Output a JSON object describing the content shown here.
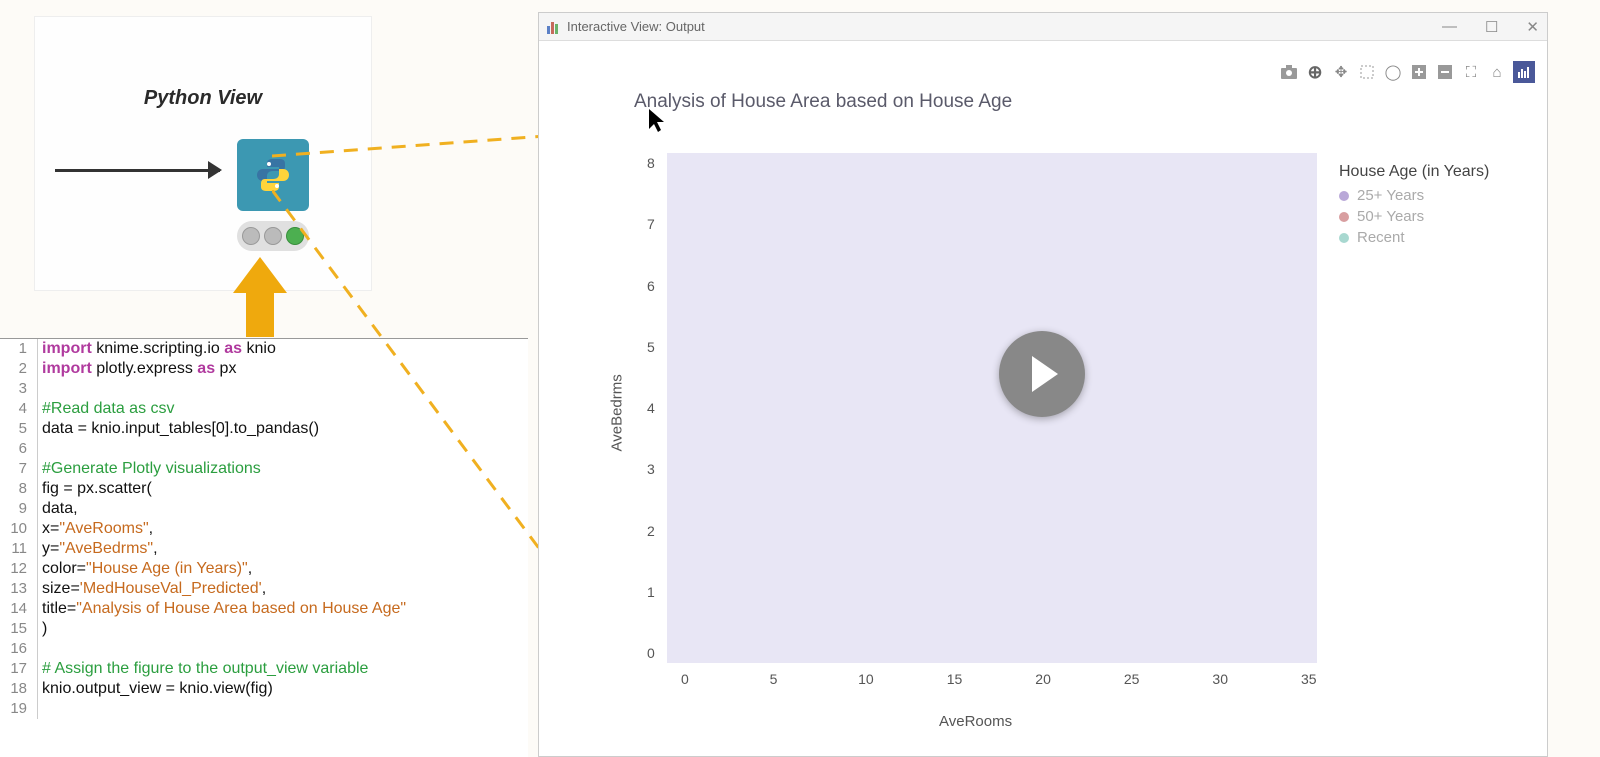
{
  "node": {
    "title": "Python View"
  },
  "window": {
    "title": "Interactive View: Output"
  },
  "plotly_toolbar": {
    "camera": "camera-icon",
    "zoom": "zoom-icon",
    "pan": "pan-icon",
    "boxselect": "box-select-icon",
    "lasso": "lasso-icon",
    "zoomin": "zoom-in-icon",
    "zoomout": "zoom-out-icon",
    "autoscale": "autoscale-icon",
    "reset": "reset-icon",
    "logo": "plotly-logo-icon"
  },
  "chart": {
    "title": "Analysis of House Area based on House Age",
    "xlabel": "AveRooms",
    "ylabel": "AveBedrms",
    "legend_title": "House Age (in Years)",
    "legend_items": [
      {
        "label": "25+ Years",
        "color": "#b9a8d8"
      },
      {
        "label": "50+ Years",
        "color": "#d89ea0"
      },
      {
        "label": "Recent",
        "color": "#a8d8d0"
      }
    ],
    "xticks": [
      "0",
      "5",
      "10",
      "15",
      "20",
      "25",
      "30",
      "35"
    ],
    "yticks": [
      "0",
      "1",
      "2",
      "3",
      "4",
      "5",
      "6",
      "7",
      "8"
    ]
  },
  "chart_data": {
    "type": "scatter",
    "title": "Analysis of House Area based on House Age",
    "xlabel": "AveRooms",
    "ylabel": "AveBedrms",
    "xlim": [
      0,
      36
    ],
    "ylim": [
      0,
      8.5
    ],
    "legend_title": "House Age (in Years)",
    "series": [
      {
        "name": "25+ Years",
        "x": [],
        "y": [],
        "size": []
      },
      {
        "name": "50+ Years",
        "x": [],
        "y": [],
        "size": []
      },
      {
        "name": "Recent",
        "x": [],
        "y": [],
        "size": []
      }
    ],
    "note": "scatter plot rendered empty/blank in screenshot; no visible data points"
  },
  "code": {
    "lines": [
      {
        "n": "1",
        "tokens": [
          {
            "t": "import ",
            "c": "kw"
          },
          {
            "t": "knime.scripting.io "
          },
          {
            "t": "as",
            "c": "kw"
          },
          {
            "t": " knio"
          }
        ]
      },
      {
        "n": "2",
        "tokens": [
          {
            "t": "import ",
            "c": "kw"
          },
          {
            "t": "plotly.express "
          },
          {
            "t": "as",
            "c": "kw"
          },
          {
            "t": " px"
          }
        ]
      },
      {
        "n": "3",
        "tokens": []
      },
      {
        "n": "4",
        "tokens": [
          {
            "t": "#Read data as csv",
            "c": "cm"
          }
        ]
      },
      {
        "n": "5",
        "tokens": [
          {
            "t": "data = knio.input_tables[0].to_pandas()"
          }
        ]
      },
      {
        "n": "6",
        "tokens": []
      },
      {
        "n": "7",
        "tokens": [
          {
            "t": "#Generate Plotly visualizations",
            "c": "cm"
          }
        ]
      },
      {
        "n": "8",
        "tokens": [
          {
            "t": "fig = px.scatter("
          }
        ]
      },
      {
        "n": "9",
        "tokens": [
          {
            "t": "data,"
          }
        ]
      },
      {
        "n": "10",
        "tokens": [
          {
            "t": "x="
          },
          {
            "t": "\"AveRooms\"",
            "c": "str"
          },
          {
            "t": ","
          }
        ]
      },
      {
        "n": "11",
        "tokens": [
          {
            "t": "y="
          },
          {
            "t": "\"AveBedrms\"",
            "c": "str"
          },
          {
            "t": ","
          }
        ]
      },
      {
        "n": "12",
        "tokens": [
          {
            "t": "color="
          },
          {
            "t": "\"House Age (in Years)\"",
            "c": "str"
          },
          {
            "t": ","
          }
        ]
      },
      {
        "n": "13",
        "tokens": [
          {
            "t": "size="
          },
          {
            "t": "'MedHouseVal_Predicted'",
            "c": "str"
          },
          {
            "t": ","
          }
        ]
      },
      {
        "n": "14",
        "tokens": [
          {
            "t": "title="
          },
          {
            "t": "\"Analysis of House Area based on House Age\"",
            "c": "str"
          }
        ]
      },
      {
        "n": "15",
        "tokens": [
          {
            "t": ")"
          }
        ]
      },
      {
        "n": "16",
        "tokens": []
      },
      {
        "n": "17",
        "tokens": [
          {
            "t": "# Assign the figure to the output_view variable",
            "c": "cm"
          }
        ]
      },
      {
        "n": "18",
        "tokens": [
          {
            "t": "knio.output_view = knio.view(fig)"
          }
        ]
      },
      {
        "n": "19",
        "tokens": []
      }
    ]
  }
}
